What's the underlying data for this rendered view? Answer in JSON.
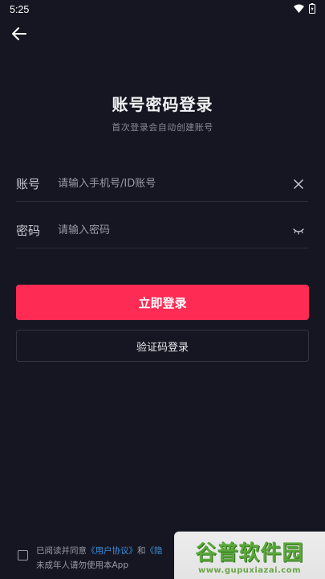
{
  "status_bar": {
    "time": "5:25",
    "icons": [
      "wifi-icon",
      "battery-icon"
    ]
  },
  "header": {
    "back_icon": "arrow-left-icon"
  },
  "main": {
    "title": "账号密码登录",
    "subtitle": "首次登录会自动创建账号",
    "account": {
      "label": "账号",
      "placeholder": "请输入手机号/ID账号",
      "value": "",
      "action_icon": "clear-icon"
    },
    "password": {
      "label": "密码",
      "placeholder": "请输入密码",
      "value": "",
      "action_icon": "eye-closed-icon"
    },
    "login_button": "立即登录",
    "code_login_button": "验证码登录"
  },
  "agreement": {
    "checked": false,
    "prefix": "已阅读并同意",
    "user_agreement": "《用户协议》",
    "and": "和",
    "privacy_partial": "《隐",
    "line2": "未成年人请勿使用本App"
  },
  "watermark": {
    "logo": "谷普软件园",
    "url": "www.gupuxiazai.com"
  },
  "colors": {
    "background": "#161622",
    "accent": "#fe2c55",
    "link": "#3a8fd9"
  }
}
